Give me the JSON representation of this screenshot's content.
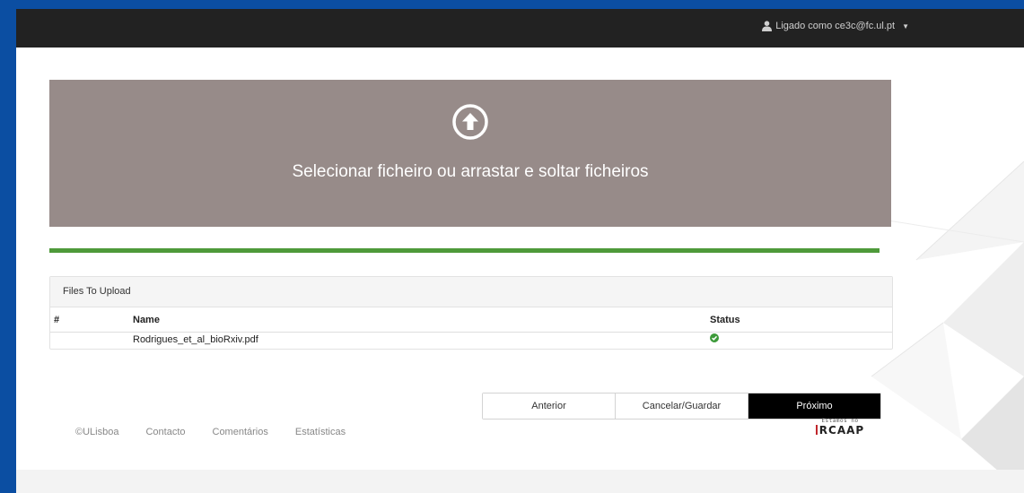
{
  "navbar": {
    "user_label": "Ligado como ce3c@fc.ul.pt",
    "user_icon": "user-icon",
    "caret_icon": "caret-down-icon"
  },
  "dropzone": {
    "icon": "upload-arrow-circle-icon",
    "text": "Selecionar ficheiro ou arrastar e soltar ficheiros"
  },
  "progress": {
    "percent": 100,
    "color": "#4e9a3a"
  },
  "files_panel": {
    "heading": "Files To Upload",
    "columns": {
      "num": "#",
      "name": "Name",
      "status": "Status"
    },
    "rows": [
      {
        "num": "",
        "name": "Rodrigues_et_al_bioRxiv.pdf",
        "status_icon": "check-circle-icon"
      }
    ]
  },
  "actions": {
    "previous": "Anterior",
    "cancel_save": "Cancelar/Guardar",
    "next": "Próximo"
  },
  "footer": {
    "copyright": "©ULisboa",
    "contact": "Contacto",
    "comments": "Comentários",
    "stats": "Estatísticas"
  },
  "rcaap": {
    "tagline": "Estamos no",
    "name": "RCAAP"
  },
  "colors": {
    "navbar": "#222222",
    "dropzone": "#978b89",
    "primary_button": "#000000",
    "frame": "#0b4ea2"
  }
}
